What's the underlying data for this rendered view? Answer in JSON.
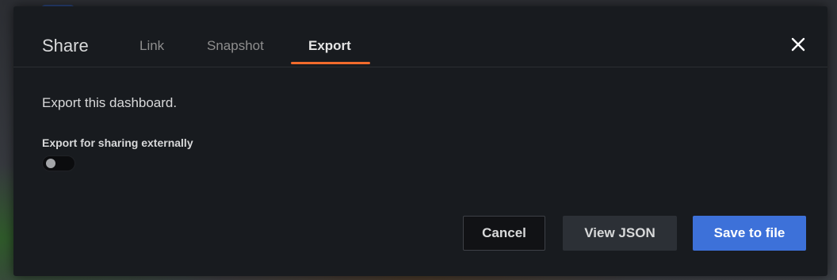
{
  "modal": {
    "title": "Share",
    "tabs": [
      {
        "label": "Link",
        "active": false
      },
      {
        "label": "Snapshot",
        "active": false
      },
      {
        "label": "Export",
        "active": true
      }
    ],
    "close_icon": "close-icon"
  },
  "export": {
    "description": "Export this dashboard.",
    "share_externally_label": "Export for sharing externally",
    "share_externally_enabled": false
  },
  "buttons": {
    "cancel": "Cancel",
    "view_json": "View JSON",
    "save_to_file": "Save to file"
  },
  "colors": {
    "modal_bg": "#181b1f",
    "active_tab_underline": "#f26b2c",
    "primary": "#3d71d9",
    "secondary": "#2c3036"
  }
}
